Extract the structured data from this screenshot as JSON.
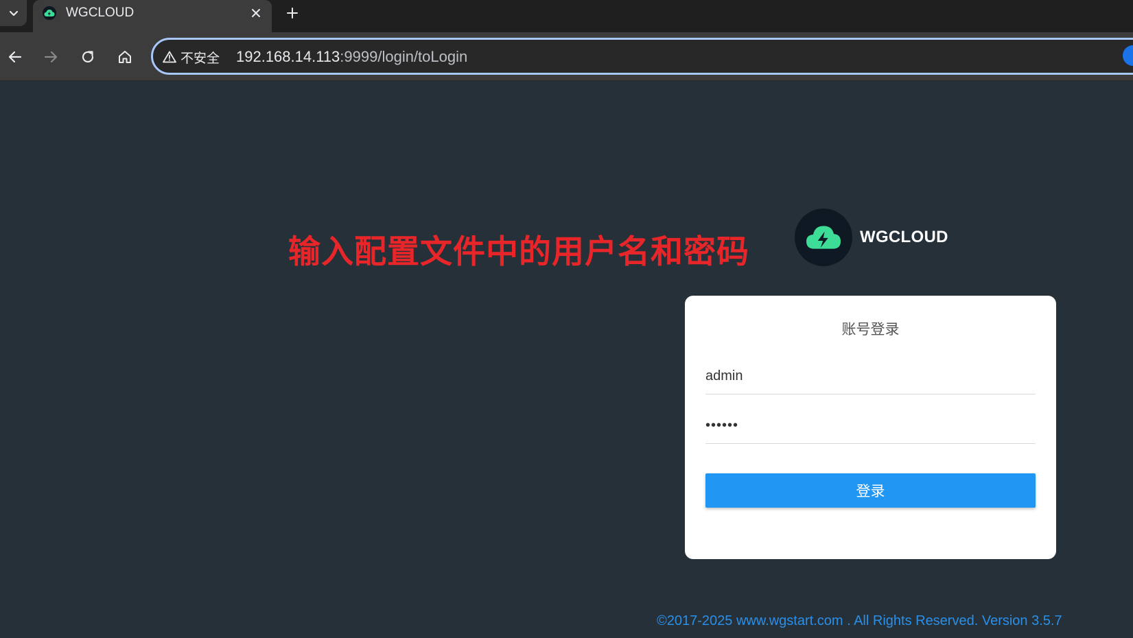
{
  "browser": {
    "tab": {
      "title": "WGCLOUD"
    },
    "omnibox": {
      "security_label": "不安全",
      "url_host": "192.168.14.113",
      "url_rest": ":9999/login/toLogin"
    }
  },
  "page": {
    "annotation": "输入配置文件中的用户名和密码",
    "brand": {
      "name": "WGCLOUD"
    },
    "login": {
      "title": "账号登录",
      "username_value": "admin",
      "password_value": "••••••",
      "submit_label": "登录"
    },
    "footer": "©2017-2025 www.wgstart.com . All Rights Reserved. Version 3.5.7"
  },
  "colors": {
    "page_bg": "#263038",
    "annotation": "#e8262a",
    "button": "#2196f3",
    "logo_cloud": "#3ddc97",
    "footer_text": "#2b8fe8"
  },
  "icons": [
    "chevron-down-icon",
    "cloud-bolt-icon",
    "close-icon",
    "plus-icon",
    "back-arrow-icon",
    "forward-arrow-icon",
    "reload-icon",
    "home-icon",
    "warning-icon"
  ]
}
